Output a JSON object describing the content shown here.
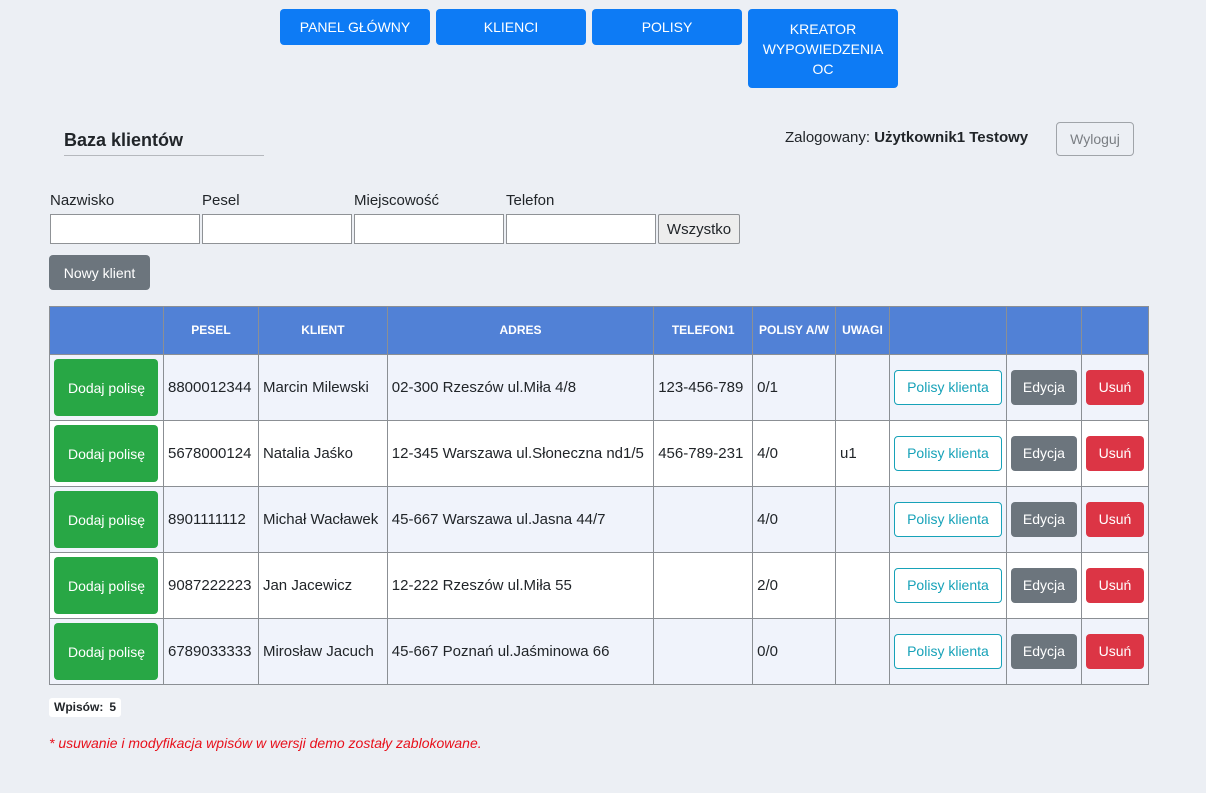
{
  "nav": {
    "items": [
      {
        "label": "PANEL GŁÓWNY"
      },
      {
        "label": "KLIENCI"
      },
      {
        "label": "POLISY"
      },
      {
        "label": "KREATOR\nWYPOWIEDZENIA\nOC"
      }
    ]
  },
  "header": {
    "title": "Baza klientów",
    "logged_prefix": "Zalogowany: ",
    "user_name": "Użytkownik1 Testowy",
    "logout_label": "Wyloguj"
  },
  "filters": {
    "surname_label": "Nazwisko",
    "pesel_label": "Pesel",
    "city_label": "Miejscowość",
    "phone_label": "Telefon",
    "surname_value": "",
    "pesel_value": "",
    "city_value": "",
    "phone_value": "",
    "all_label": "Wszystko"
  },
  "new_client_label": "Nowy klient",
  "table": {
    "headers": [
      "",
      "PESEL",
      "KLIENT",
      "ADRES",
      "TELEFON1",
      "POLISY A/W",
      "UWAGI",
      "",
      "",
      ""
    ],
    "add_policy_label": "Dodaj polisę",
    "client_policies_label": "Polisy klienta",
    "edit_label": "Edycja",
    "delete_label": "Usuń",
    "rows": [
      {
        "pesel": "8800012344",
        "client": "Marcin Milewski",
        "address": "02-300 Rzeszów ul.Miła 4/8",
        "phone": "123-456-789",
        "policies": "0/1",
        "notes": ""
      },
      {
        "pesel": "5678000124",
        "client": "Natalia Jaśko",
        "address": "12-345 Warszawa ul.Słoneczna nd1/5",
        "phone": "456-789-231",
        "policies": "4/0",
        "notes": "u1"
      },
      {
        "pesel": "8901111112",
        "client": "Michał Wacławek",
        "address": "45-667 Warszawa ul.Jasna 44/7",
        "phone": "",
        "policies": "4/0",
        "notes": ""
      },
      {
        "pesel": "9087222223",
        "client": "Jan Jacewicz",
        "address": "12-222 Rzeszów ul.Miła 55",
        "phone": "",
        "policies": "2/0",
        "notes": ""
      },
      {
        "pesel": "6789033333",
        "client": "Mirosław Jacuch",
        "address": "45-667 Poznań ul.Jaśminowa 66",
        "phone": "",
        "policies": "0/0",
        "notes": ""
      }
    ]
  },
  "count": {
    "label": "Wpisów:",
    "value": "5"
  },
  "demo_note": "* usuwanie i modyfikacja wpisów w wersji demo zostały zablokowane.",
  "colors": {
    "primary": "#0d7bf5",
    "table_header": "#5181d6",
    "success": "#28a745",
    "secondary": "#6c757d",
    "danger": "#dc3545",
    "info": "#17a2b8",
    "note": "#e8101b"
  }
}
